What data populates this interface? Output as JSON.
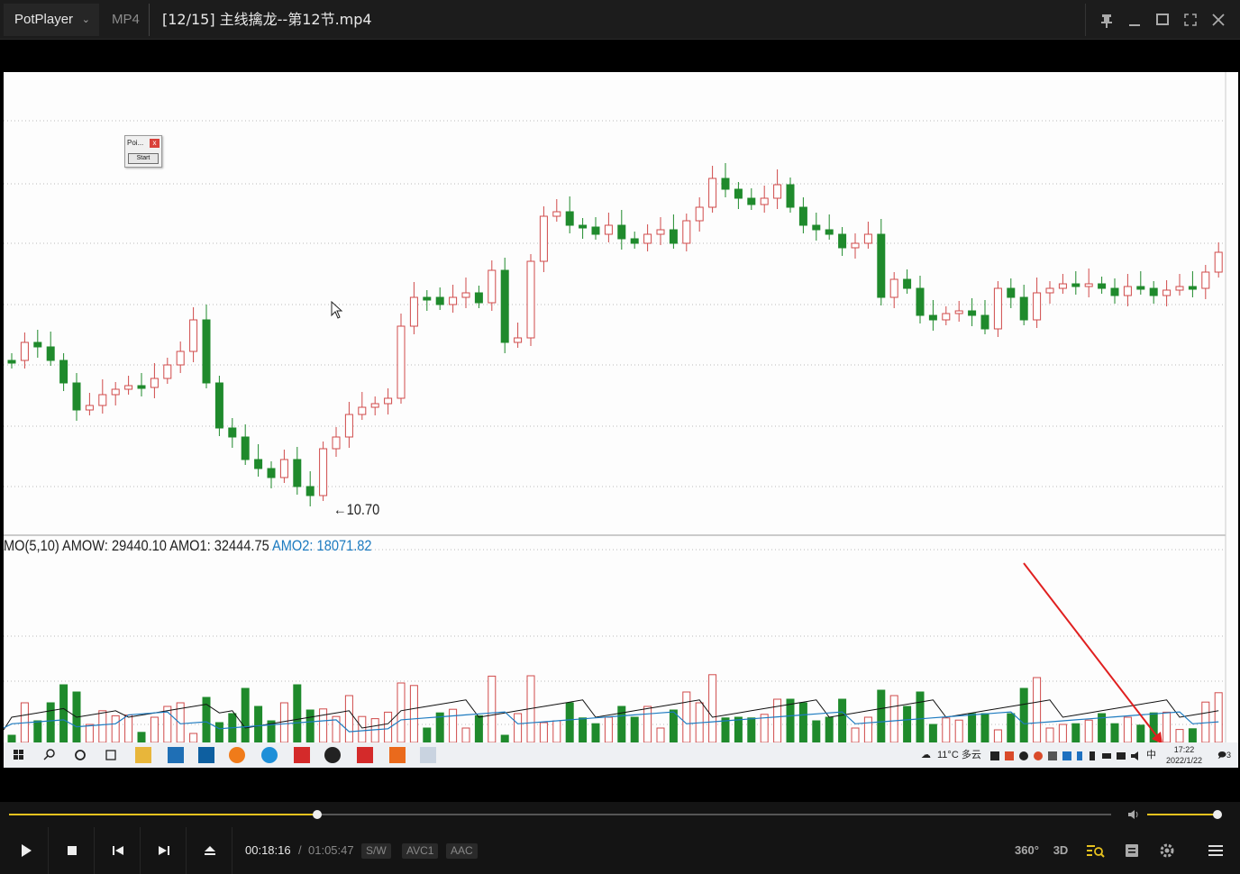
{
  "app": {
    "brand": "PotPlayer",
    "format": "MP4",
    "title": "[12/15] 主线擒龙--第12节.mp4"
  },
  "chart": {
    "indicator_label": "MO(5,10)  AMOW: 29440.10  AMO1: 32444.75",
    "indicator_label_blue": "AMO2: 18071.82",
    "price_note": "10.70",
    "colors": {
      "up": "#d04a4a",
      "down": "#1f8a2c",
      "ma1": "#111111",
      "ma2": "#1d7bc0",
      "annotation": "#e02020"
    }
  },
  "overlay_window": {
    "title": "Poi...",
    "close": "x",
    "button": "Start"
  },
  "taskbar": {
    "weather": "11°C 多云",
    "ime": "中",
    "time": "17:22",
    "date": "2022/1/22",
    "notifications": "3"
  },
  "playback": {
    "current_time": "00:18:16",
    "separator": "/",
    "duration": "01:05:47",
    "tags": [
      "S/W",
      "AVC1",
      "AAC"
    ],
    "progress": 0.28,
    "volume": 0.95
  },
  "right_controls": {
    "vr_label": "360°",
    "stereo_label": "3D"
  }
}
